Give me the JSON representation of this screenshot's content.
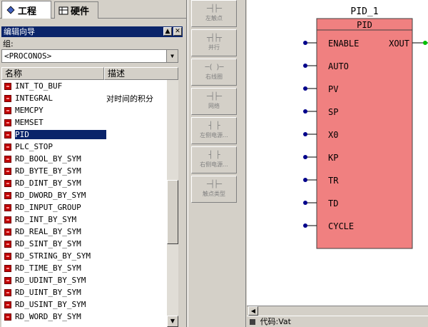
{
  "tabs": [
    {
      "label": "工程"
    },
    {
      "label": "硬件"
    }
  ],
  "panel": {
    "title": "编辑向导",
    "group_label": "组:",
    "group_value": "<PROCONOS>",
    "columns": {
      "name": "名称",
      "desc": "描述"
    }
  },
  "list": [
    {
      "name": "INT_TO_BUF",
      "desc": ""
    },
    {
      "name": "INTEGRAL",
      "desc": "对时间的积分"
    },
    {
      "name": "MEMCPY",
      "desc": ""
    },
    {
      "name": "MEMSET",
      "desc": ""
    },
    {
      "name": "PID",
      "desc": ""
    },
    {
      "name": "PLC_STOP",
      "desc": ""
    },
    {
      "name": "RD_BOOL_BY_SYM",
      "desc": ""
    },
    {
      "name": "RD_BYTE_BY_SYM",
      "desc": ""
    },
    {
      "name": "RD_DINT_BY_SYM",
      "desc": ""
    },
    {
      "name": "RD_DWORD_BY_SYM",
      "desc": ""
    },
    {
      "name": "RD_INPUT_GROUP",
      "desc": ""
    },
    {
      "name": "RD_INT_BY_SYM",
      "desc": ""
    },
    {
      "name": "RD_REAL_BY_SYM",
      "desc": ""
    },
    {
      "name": "RD_SINT_BY_SYM",
      "desc": ""
    },
    {
      "name": "RD_STRING_BY_SYM",
      "desc": ""
    },
    {
      "name": "RD_TIME_BY_SYM",
      "desc": ""
    },
    {
      "name": "RD_UDINT_BY_SYM",
      "desc": ""
    },
    {
      "name": "RD_UINT_BY_SYM",
      "desc": ""
    },
    {
      "name": "RD_USINT_BY_SYM",
      "desc": ""
    },
    {
      "name": "RD_WORD_BY_SYM",
      "desc": ""
    }
  ],
  "selected_item": "PID",
  "toolbar": [
    {
      "symbol": "─┤├─",
      "label": "左触点"
    },
    {
      "symbol": "┬┤├┬",
      "label": "并行"
    },
    {
      "symbol": "─( )─",
      "label": "右线圈"
    },
    {
      "symbol": "─┤├─",
      "label": "网络"
    },
    {
      "symbol": "┤ ├",
      "label": "左侧电源..."
    },
    {
      "symbol": "┤ ├",
      "label": "右侧电源..."
    },
    {
      "symbol": "─┤├─",
      "label": "触点类型"
    }
  ],
  "block": {
    "instance_name": "PID_1",
    "type_name": "PID",
    "inputs": [
      "ENABLE",
      "AUTO",
      "PV",
      "SP",
      "X0",
      "KP",
      "TR",
      "TD",
      "CYCLE"
    ],
    "outputs": [
      "XOUT"
    ],
    "fill_color": "#f08080"
  },
  "bottom_tab": "代码:Vat",
  "colors": {
    "title_bar": "#0a246a",
    "selection": "#0a246a",
    "item_icon": "#c00000",
    "input_dot": "#00008b",
    "output_dot": "#00c000"
  }
}
